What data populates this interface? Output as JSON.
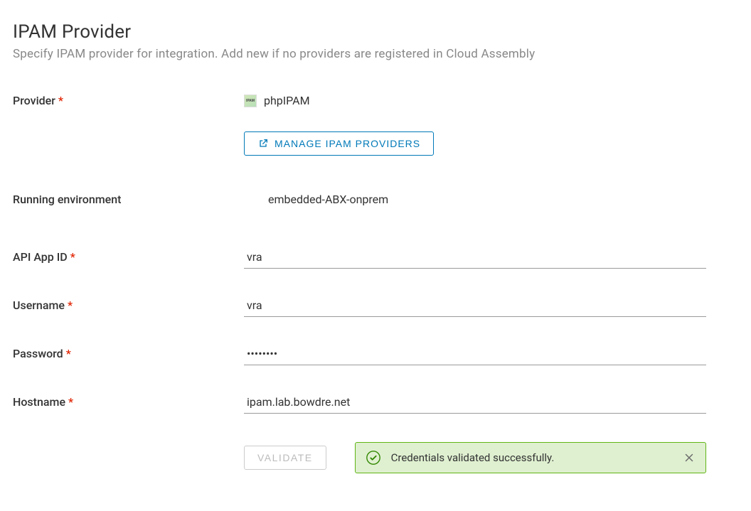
{
  "header": {
    "title": "IPAM Provider",
    "subtitle": "Specify IPAM provider for integration. Add new if no providers are registered in Cloud Assembly"
  },
  "labels": {
    "provider": "Provider",
    "running_env": "Running environment",
    "api_app_id": "API App ID",
    "username": "Username",
    "password": "Password",
    "hostname": "Hostname"
  },
  "buttons": {
    "manage_providers": "MANAGE IPAM PROVIDERS",
    "validate": "VALIDATE"
  },
  "values": {
    "provider_name": "phpIPAM",
    "running_env": "embedded-ABX-onprem",
    "api_app_id": "vra",
    "username": "vra",
    "password": "••••••••",
    "hostname": "ipam.lab.bowdre.net"
  },
  "alert": {
    "message": "Credentials validated successfully."
  }
}
